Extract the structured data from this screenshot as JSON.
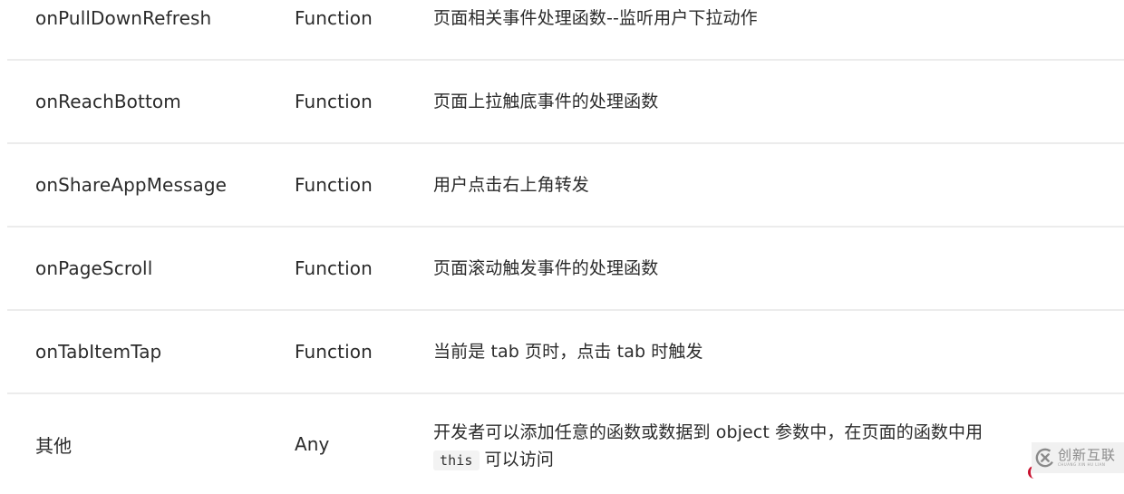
{
  "rows": [
    {
      "name": "onPullDownRefresh",
      "type": "Function",
      "description": "页面相关事件处理函数--监听用户下拉动作"
    },
    {
      "name": "onReachBottom",
      "type": "Function",
      "description": "页面上拉触底事件的处理函数"
    },
    {
      "name": "onShareAppMessage",
      "type": "Function",
      "description": "用户点击右上角转发"
    },
    {
      "name": "onPageScroll",
      "type": "Function",
      "description": "页面滚动触发事件的处理函数"
    },
    {
      "name": "onTabItemTap",
      "type": "Function",
      "description": "当前是 tab 页时，点击 tab 时触发"
    },
    {
      "name": "其他",
      "type": "Any",
      "description": "开发者可以添加任意的函数或数据到 object 参数中，在页面的函数中用",
      "code": "this",
      "description_after_code": "可以访问"
    }
  ],
  "watermark": {
    "icon": "chuangxin-logo-icon",
    "text": "创新互联",
    "subtext": "CHUANG XIN HU LIAN",
    "color": "#8a8a8a"
  },
  "colors": {
    "text": "#2b2b2b",
    "divider": "#ececec",
    "code_bg": "#f3f3f3",
    "accent_red": "#c8102e"
  }
}
